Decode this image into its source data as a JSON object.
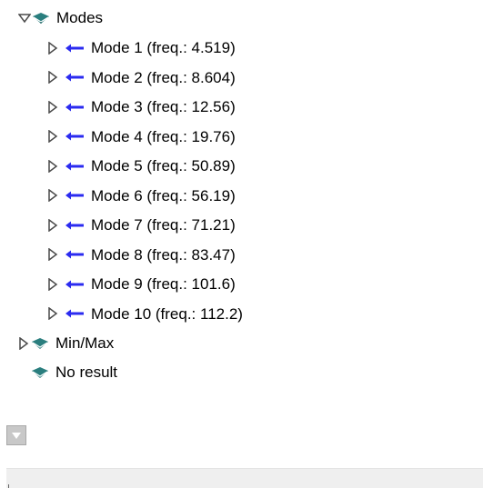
{
  "tree": {
    "modes": {
      "label": "Modes",
      "expanded": true,
      "icon": "book-icon",
      "items": [
        {
          "label": "Mode 1 (freq.: 4.519)"
        },
        {
          "label": "Mode 2 (freq.: 8.604)"
        },
        {
          "label": "Mode 3 (freq.: 12.56)"
        },
        {
          "label": "Mode 4 (freq.: 19.76)"
        },
        {
          "label": "Mode 5 (freq.: 50.89)"
        },
        {
          "label": "Mode 6 (freq.: 56.19)"
        },
        {
          "label": "Mode 7 (freq.: 71.21)"
        },
        {
          "label": "Mode 8 (freq.: 83.47)"
        },
        {
          "label": "Mode 9 (freq.: 101.6)"
        },
        {
          "label": "Mode 10 (freq.: 112.2)"
        }
      ]
    },
    "minmax": {
      "label": "Min/Max",
      "expanded": false,
      "icon": "book-icon"
    },
    "noresult": {
      "label": "No result",
      "icon": "book-icon"
    }
  },
  "colors": {
    "arrow": "#2b2bf0",
    "book": "#2a7e7e",
    "twisty": "#4a4a4a"
  }
}
